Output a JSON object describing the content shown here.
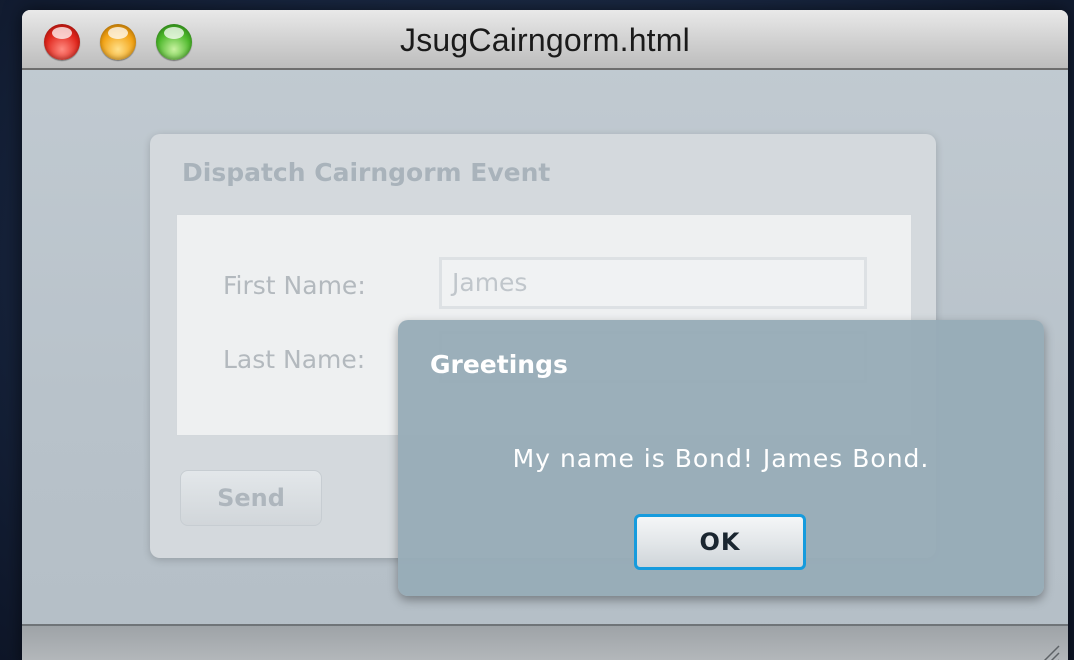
{
  "window": {
    "title": "JsugCairngorm.html"
  },
  "panel": {
    "title": "Dispatch Cairngorm Event",
    "first_name_label": "First Name:",
    "first_name_value": "James",
    "last_name_label": "Last Name:",
    "last_name_value": "",
    "send_label": "Send"
  },
  "dialog": {
    "title": "Greetings",
    "message": "My name is Bond! James Bond.",
    "ok_label": "OK"
  },
  "colors": {
    "dialog_background": "#97acb7",
    "ok_focus_ring": "#169bdd",
    "close_button": "#e0251b",
    "minimize_button": "#f2a214",
    "zoom_button": "#4cb82a"
  },
  "icons": [
    "close-button-icon",
    "minimize-button-icon",
    "zoom-button-icon",
    "resize-grip-icon"
  ]
}
